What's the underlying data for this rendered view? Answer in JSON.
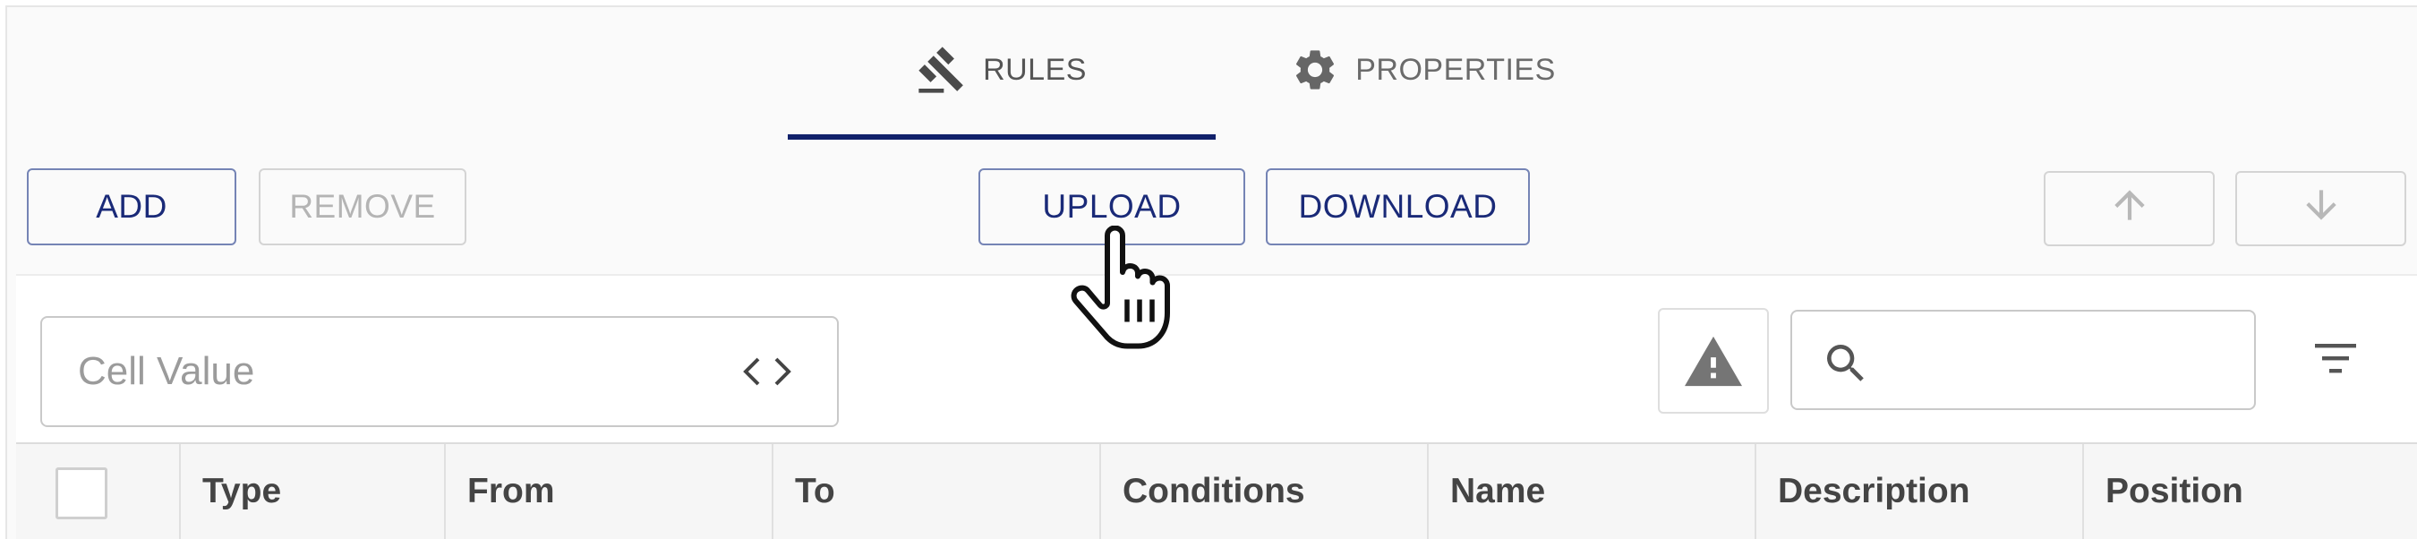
{
  "tabs": [
    {
      "label": "RULES",
      "icon": "gavel-icon",
      "active": true
    },
    {
      "label": "PROPERTIES",
      "icon": "gear-icon",
      "active": false
    }
  ],
  "toolbar": {
    "add_label": "ADD",
    "remove_label": "REMOVE",
    "upload_label": "UPLOAD",
    "download_label": "DOWNLOAD",
    "move_up_icon": "arrow-up-icon",
    "move_down_icon": "arrow-down-icon"
  },
  "filter_bar": {
    "cell_value_placeholder": "Cell Value",
    "search_value": "",
    "search_placeholder": ""
  },
  "table": {
    "columns": [
      "Type",
      "From",
      "To",
      "Conditions",
      "Name",
      "Description",
      "Position"
    ]
  },
  "colors": {
    "accent": "#11216b",
    "button_text": "#1a2a78",
    "button_border": "#7584b5",
    "disabled": "#b4b4b4"
  }
}
